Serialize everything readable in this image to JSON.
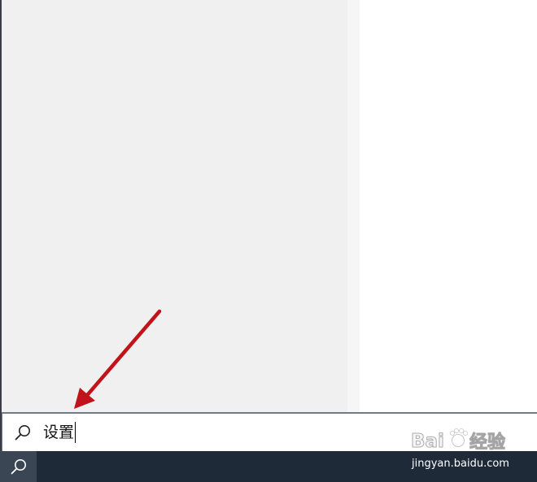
{
  "search": {
    "query": "设置",
    "icon": "search-icon"
  },
  "taskbar": {
    "search_icon": "search-icon"
  },
  "annotation": {
    "color": "#c0141a",
    "icon": "red-arrow"
  },
  "watermark": {
    "logo": "Baidu经验",
    "url": "jingyan.baidu.com"
  },
  "colors": {
    "panel_bg": "#f0f0f0",
    "taskbar_bg": "#1f2a38",
    "search_border": "#6f7a8a"
  }
}
